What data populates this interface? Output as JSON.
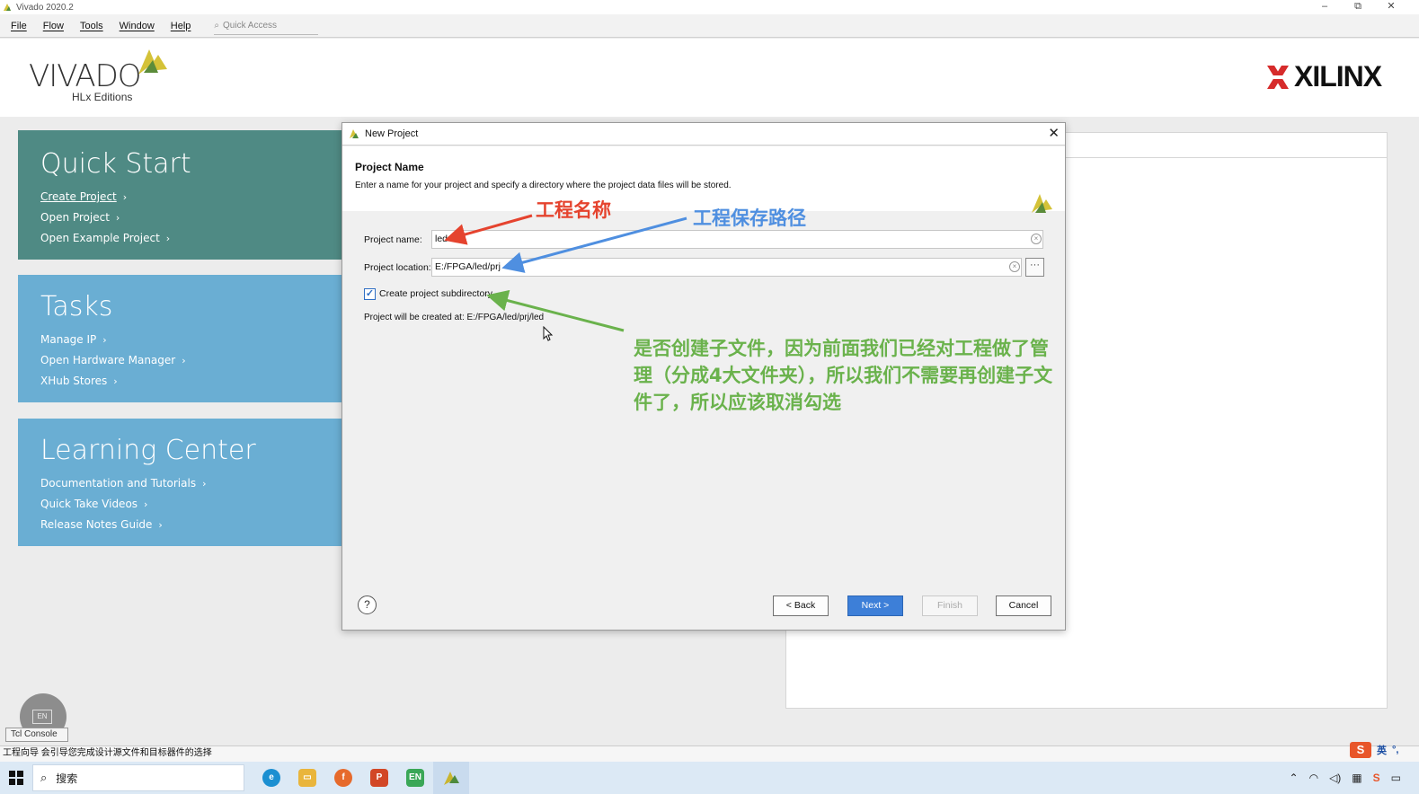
{
  "window": {
    "title": "Vivado 2020.2",
    "minimize": "–",
    "restore": "⧉",
    "close": "✕"
  },
  "menu": {
    "items": [
      "File",
      "Flow",
      "Tools",
      "Window",
      "Help"
    ],
    "quick_access_placeholder": "Quick Access"
  },
  "header": {
    "vivado": "VIVADO",
    "vivado_sub": "HLx Editions",
    "xilinx": "XILINX"
  },
  "quick_start": {
    "title": "Quick Start",
    "links": [
      "Create Project",
      "Open Project",
      "Open Example Project"
    ]
  },
  "tasks": {
    "title": "Tasks",
    "links": [
      "Manage IP",
      "Open Hardware Manager",
      "XHub Stores"
    ]
  },
  "learning_center": {
    "title": "Learning Center",
    "links": [
      "Documentation and Tutorials",
      "Quick Take Videos",
      "Release Notes Guide"
    ]
  },
  "dialog": {
    "title": "New Project",
    "section_title": "Project Name",
    "section_desc": "Enter a name for your project and specify a directory where the project data files will be stored.",
    "project_name_label": "Project name:",
    "project_name_value": "led",
    "project_location_label": "Project location:",
    "project_location_value": "E:/FPGA/led/prj",
    "browse_label": "···",
    "create_subdir_label": "Create project subdirectory",
    "create_subdir_checked": true,
    "created_at": "Project will be created at: E:/FPGA/led/prj/led",
    "help": "?",
    "buttons": {
      "back": "< Back",
      "next": "Next >",
      "finish": "Finish",
      "cancel": "Cancel"
    }
  },
  "annotations": {
    "project_name": "工程名称",
    "project_path": "工程保存路径",
    "subdirectory": "是否创建子文件，因为前面我们已经对工程做了管理（分成4大文件夹），所以我们不需要再创建子文件了，所以应该取消勾选",
    "colors": {
      "red": "#e5432e",
      "blue": "#4f8fe0",
      "green": "#6ab24c"
    }
  },
  "console": {
    "tab": "Tcl Console",
    "en_bubble": "EN"
  },
  "statusbar": {
    "text": "工程向导 会引导您完成设计源文件和目标器件的选择"
  },
  "ime": {
    "logo": "S",
    "lang": "英",
    "punct": "°,"
  },
  "taskbar": {
    "search": "搜索",
    "apps": [
      "edge-icon",
      "explorer-icon",
      "firefox-icon",
      "powerpoint-icon",
      "en-app-icon",
      "vivado-icon"
    ],
    "tray": [
      "^",
      "wifi",
      "volume",
      "keyboard",
      "sogou",
      "notifications"
    ]
  }
}
